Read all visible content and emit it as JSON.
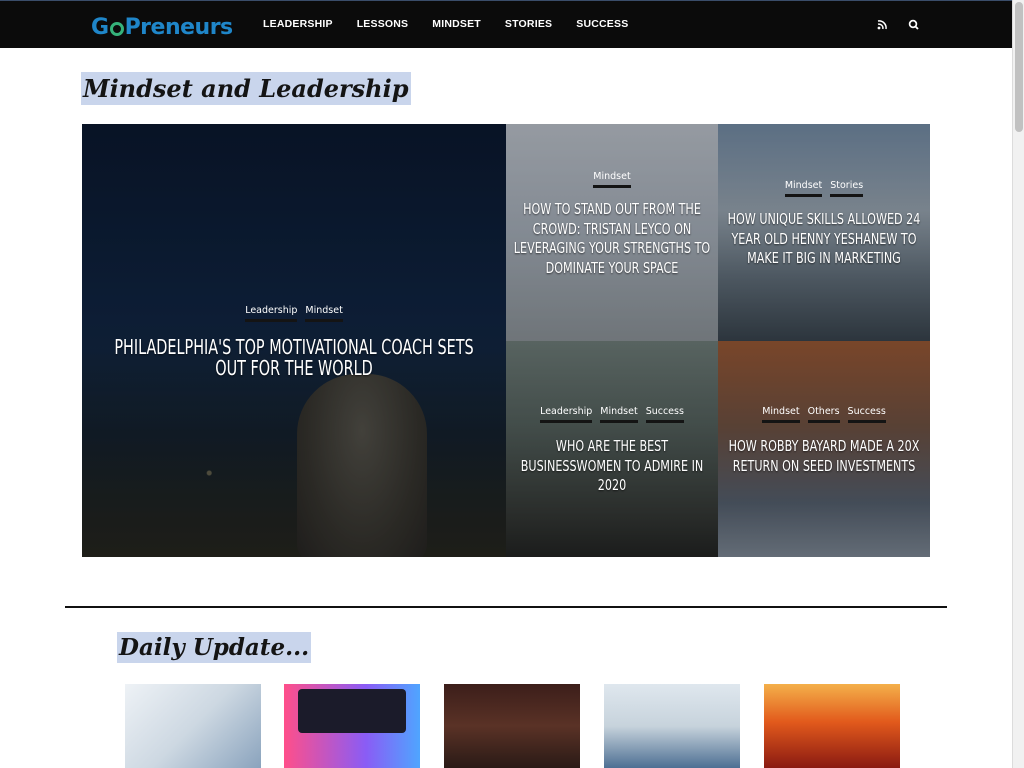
{
  "site": {
    "logo_text_pre": "G",
    "logo_text_post": "Preneurs"
  },
  "nav": {
    "items": [
      "LEADERSHIP",
      "LESSONS",
      "MINDSET",
      "STORIES",
      "SUCCESS"
    ],
    "icons": [
      "rss-icon",
      "search-icon"
    ]
  },
  "section1": {
    "heading": "Mindset and Leadership"
  },
  "featured": {
    "main": {
      "categories": [
        "Leadership",
        "Mindset"
      ],
      "title": "PHILADELPHIA'S TOP MOTIVATIONAL COACH SETS OUT FOR THE WORLD"
    },
    "a": {
      "categories": [
        "Mindset"
      ],
      "title": "HOW TO STAND OUT FROM THE CROWD: TRISTAN LEYCO ON LEVERAGING YOUR STRENGTHS TO DOMINATE YOUR SPACE"
    },
    "b": {
      "categories": [
        "Mindset",
        "Stories"
      ],
      "title": "HOW UNIQUE SKILLS ALLOWED 24 YEAR OLD HENNY YESHANEW TO MAKE IT BIG IN MARKETING"
    },
    "c": {
      "categories": [
        "Leadership",
        "Mindset",
        "Success"
      ],
      "title": "WHO ARE THE BEST BUSINESSWOMEN TO ADMIRE IN 2020"
    },
    "d": {
      "categories": [
        "Mindset",
        "Others",
        "Success"
      ],
      "title": "HOW ROBBY BAYARD MADE A 20X RETURN ON SEED INVESTMENTS"
    }
  },
  "section2": {
    "heading": "Daily Update..."
  },
  "colors": {
    "nav_bg": "#0b0b0b",
    "logo_blue": "#1f86c9",
    "logo_green": "#35b27a",
    "heading_highlight": "#c9d5ec"
  }
}
